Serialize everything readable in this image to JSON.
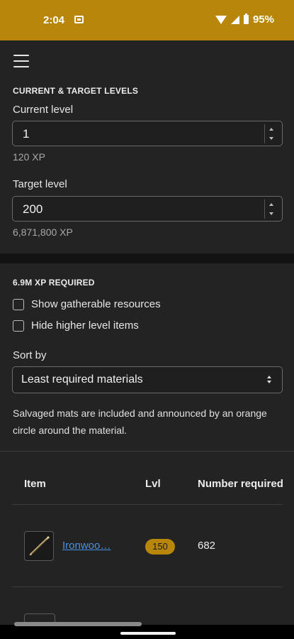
{
  "status_bar": {
    "time": "2:04",
    "battery": "95%"
  },
  "levels": {
    "section_title": "CURRENT & TARGET LEVELS",
    "current": {
      "label": "Current level",
      "value": "1",
      "xp": "120 XP"
    },
    "target": {
      "label": "Target level",
      "value": "200",
      "xp": "6,871,800 XP"
    }
  },
  "required": {
    "section_title": "6.9M XP REQUIRED",
    "show_gatherable": "Show gatherable resources",
    "hide_higher": "Hide higher level items",
    "sort_label": "Sort by",
    "sort_value": "Least required materials",
    "note": "Salvaged mats are included and announced by an orange circle around the material."
  },
  "table": {
    "headers": {
      "item": "Item",
      "lvl": "Lvl",
      "number": "Number required"
    },
    "rows": [
      {
        "name": "Ironwoo…",
        "lvl": "150",
        "number": "682"
      }
    ]
  },
  "colors": {
    "accent": "#b8860b",
    "link": "#4a90e2",
    "background": "#232323"
  },
  "icons": {
    "menu": "hamburger-icon",
    "item": "ironwood-stick-icon"
  }
}
